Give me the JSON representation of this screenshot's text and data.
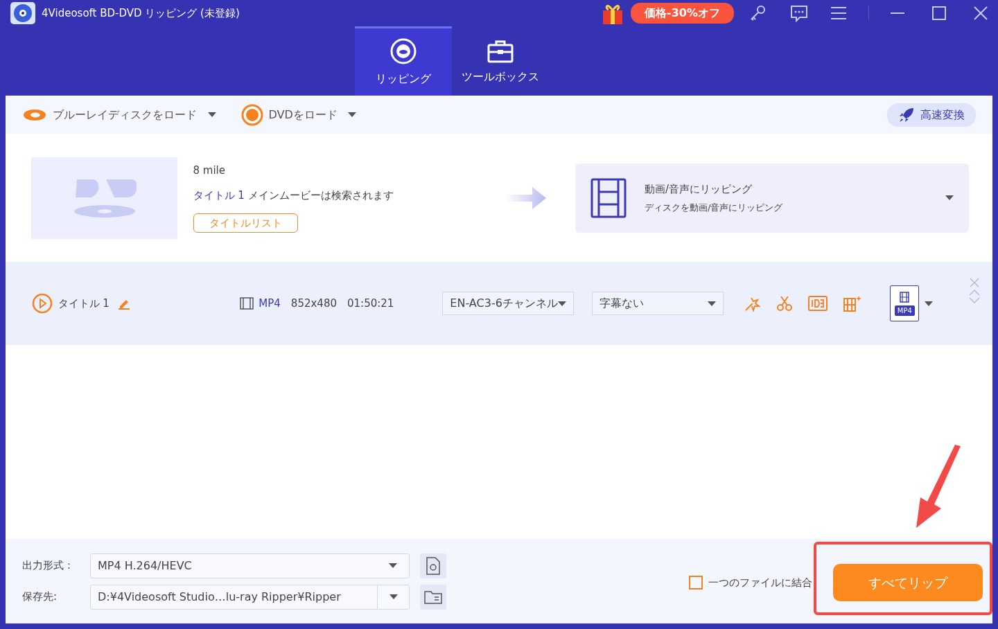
{
  "window": {
    "title": "4Videosoft BD-DVD リッピング (未登録)"
  },
  "promo": {
    "label": "価格-30%オフ"
  },
  "tabs": [
    {
      "label": "リッピング",
      "selected": true,
      "kind": "disc"
    },
    {
      "label": "ツールボックス",
      "selected": false,
      "kind": "toolbox"
    }
  ],
  "toolbar": {
    "load_bluray": "ブルーレイディスクをロード",
    "load_dvd": "DVDをロード",
    "turbo": "高速変換"
  },
  "disc": {
    "name": "8 mile",
    "detected_title": "タイトル 1",
    "detected_text": "メインムービーは検索されます",
    "title_list_button": "タイトルリスト",
    "output_mode": {
      "title": "動画/音声にリッピング",
      "subtitle": "ディスクを動画/音声にリッピング"
    }
  },
  "titles": [
    {
      "name": "タイトル 1",
      "format": "MP4",
      "resolution": "852x480",
      "duration": "01:50:21",
      "audio": "EN-AC3-6チャンネル",
      "subtitle": "字幕ない",
      "output_badge": "MP4"
    }
  ],
  "bottom": {
    "output_format_label": "出力形式：",
    "output_format": "MP4 H.264/HEVC",
    "save_label": "保存先:",
    "save_path": "D:¥4Videosoft Studio…lu-ray Ripper¥Ripper",
    "merge": {
      "label": "一つのファイルに結合",
      "checked": false
    },
    "rip_all_button": "すべてリップ"
  }
}
